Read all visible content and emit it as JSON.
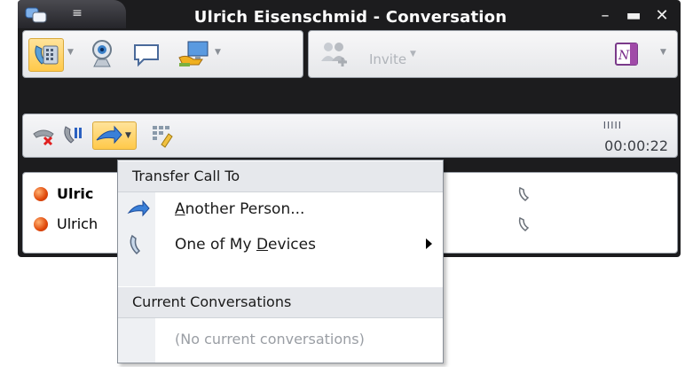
{
  "window": {
    "title": "Ulrich Eisenschmid - Conversation",
    "title_color": "#ffffff",
    "frame_color": "#1c1c1e"
  },
  "toolbar": {
    "invite_label": "Invite",
    "buttons": [
      "phone-icon",
      "webcam-icon",
      "chat-bubble-icon",
      "share-desktop-icon",
      "invite-icon",
      "onenote-icon"
    ]
  },
  "callbar": {
    "timer": "00:00:22",
    "signal": "IIIII",
    "buttons": [
      "hangup-icon",
      "hold-icon",
      "transfer-icon",
      "keypad-icon"
    ]
  },
  "participants": [
    {
      "name": "Ulric",
      "bold": true,
      "status_color": "#e0480a"
    },
    {
      "name": "Ulrich",
      "bold": false,
      "status_color": "#e0480a"
    }
  ],
  "menu": {
    "header_transfer": "Transfer Call To",
    "another_person_prefix": "",
    "another_person_underline": "A",
    "another_person_rest": "nother Person...",
    "devices_prefix": "One of My ",
    "devices_underline": "D",
    "devices_rest": "evices",
    "header_current": "Current Conversations",
    "no_conversations": "(No current conversations)"
  }
}
